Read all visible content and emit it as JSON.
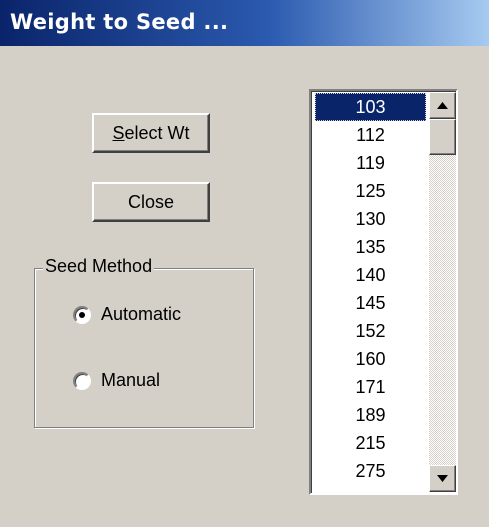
{
  "window": {
    "title": "Weight to Seed ..."
  },
  "buttons": {
    "select_wt": {
      "underline_char": "S",
      "rest": "elect Wt"
    },
    "close": "Close"
  },
  "seed_method": {
    "legend": "Seed Method",
    "options": [
      {
        "label": "Automatic",
        "checked": true
      },
      {
        "label": "Manual",
        "checked": false
      }
    ]
  },
  "weights_list": {
    "items": [
      "103",
      "112",
      "119",
      "125",
      "130",
      "135",
      "140",
      "145",
      "152",
      "160",
      "171",
      "189",
      "215",
      "275"
    ],
    "selected": "103"
  },
  "colors": {
    "face": "#d4d0c8",
    "title_start": "#0a246a",
    "title_end": "#a6caf0",
    "selection": "#0a246a"
  },
  "icons": {
    "scroll_up": "triangle-up-icon",
    "scroll_down": "triangle-down-icon"
  }
}
